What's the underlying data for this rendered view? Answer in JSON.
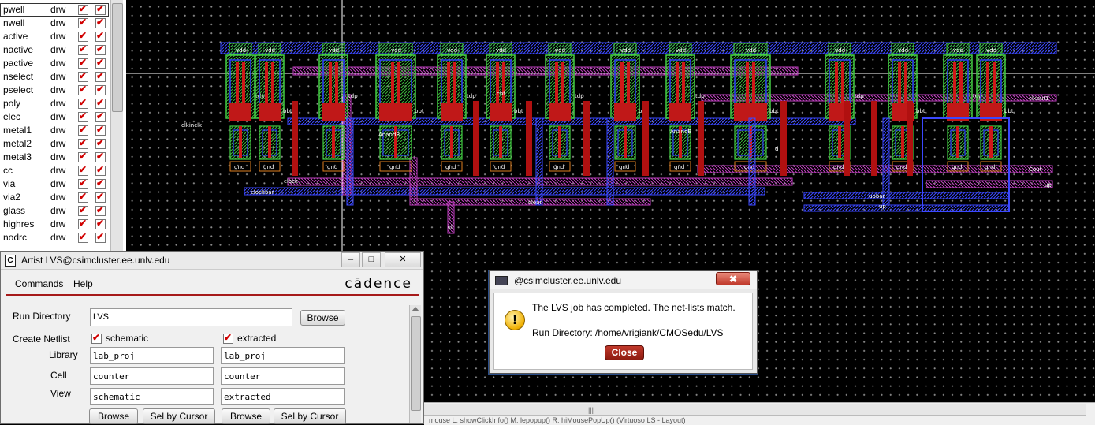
{
  "layer_palette": {
    "layers": [
      {
        "name": "pwell",
        "purpose": "drw",
        "selected": true
      },
      {
        "name": "nwell",
        "purpose": "drw"
      },
      {
        "name": "active",
        "purpose": "drw"
      },
      {
        "name": "nactive",
        "purpose": "drw"
      },
      {
        "name": "pactive",
        "purpose": "drw"
      },
      {
        "name": "nselect",
        "purpose": "drw"
      },
      {
        "name": "pselect",
        "purpose": "drw"
      },
      {
        "name": "poly",
        "purpose": "drw"
      },
      {
        "name": "elec",
        "purpose": "drw"
      },
      {
        "name": "metal1",
        "purpose": "drw"
      },
      {
        "name": "metal2",
        "purpose": "drw"
      },
      {
        "name": "metal3",
        "purpose": "drw"
      },
      {
        "name": "cc",
        "purpose": "drw"
      },
      {
        "name": "via",
        "purpose": "drw"
      },
      {
        "name": "via2",
        "purpose": "drw"
      },
      {
        "name": "glass",
        "purpose": "drw"
      },
      {
        "name": "highres",
        "purpose": "drw"
      },
      {
        "name": "nodrc",
        "purpose": "drw"
      }
    ],
    "check_color": "#d00000"
  },
  "layout": {
    "labels": {
      "vdd": "vdd",
      "gnd": "gnd",
      "clkinclk": "clkinclk",
      "clock": "clock",
      "clockbar": "clockbar",
      "clear": "clear",
      "clr": "clr",
      "anand": "AnandB",
      "clkout1": "clkout1",
      "cout": "Cout",
      "up": "up",
      "upbar": "upbar",
      "tdp": "tdp",
      "bbt": "bbt",
      "cbt": "cbt",
      "d": "d"
    },
    "colors": {
      "background": "#000000",
      "dots": "#8a8a8a",
      "metal1": "#2e3cff",
      "metal2": "#c040c0",
      "poly": "#d01818",
      "active": "#2fae2f",
      "select": "#44cc44"
    }
  },
  "lvs_window": {
    "title": "Artist LVS@csimcluster.ee.unlv.edu",
    "icon": "C",
    "minimize_icon": "‒",
    "maximize_icon": "□",
    "close_icon": "✕",
    "menu": {
      "commands": "Commands",
      "help": "Help"
    },
    "logo": "cādence",
    "run_directory": {
      "label": "Run Directory",
      "value": "LVS",
      "browse": "Browse"
    },
    "create_netlist": {
      "label": "Create Netlist",
      "schematic": "schematic",
      "extracted": "extracted",
      "schematic_checked": true,
      "extracted_checked": true
    },
    "library": {
      "label": "Library",
      "schematic": "lab_proj",
      "extracted": "lab_proj"
    },
    "cell": {
      "label": "Cell",
      "schematic": "counter",
      "extracted": "counter"
    },
    "view": {
      "label": "View",
      "schematic": "schematic",
      "extracted": "extracted"
    },
    "buttons": {
      "browse": "Browse",
      "sel_by_cursor": "Sel by Cursor"
    }
  },
  "dialog": {
    "title": "@csimcluster.ee.unlv.edu",
    "close_x": "✖",
    "message": "The LVS job has completed. The net-lists match.",
    "run_dir": "Run Directory: /home/vrigiank/CMOSedu/LVS",
    "close": "Close",
    "warn_glyph": "!"
  },
  "statusbar": {
    "grip": "|||",
    "text": "mouse L: showClickInfo()    M: lepopup()    R: hiMousePopUp()         (Virtuoso LS - Layout)"
  }
}
